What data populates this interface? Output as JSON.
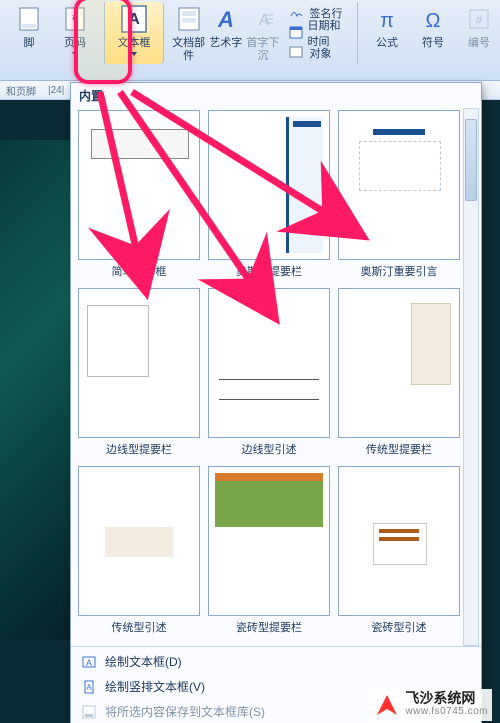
{
  "ribbon": {
    "header_footer_group": "和页脚",
    "items": {
      "footnote": "脚",
      "page_number": "页码",
      "text_box": "文本框",
      "quick_parts": "文档部件",
      "word_art": "艺术字",
      "drop_cap": "首字下沉",
      "signature": "签名行",
      "date_time": "日期和时间",
      "object": "对象",
      "equation": "公式",
      "symbol": "符号",
      "number": "编号"
    }
  },
  "ruler": {
    "marks": [
      "|24|",
      "|24|"
    ]
  },
  "dropdown": {
    "title": "内置",
    "tiles": [
      {
        "label": "简单文本框"
      },
      {
        "label": "奥斯汀提要栏"
      },
      {
        "label": "奥斯汀重要引言"
      },
      {
        "label": "边线型提要栏"
      },
      {
        "label": "边线型引述"
      },
      {
        "label": "传统型提要栏"
      },
      {
        "label": "传统型引述"
      },
      {
        "label": "瓷砖型提要栏"
      },
      {
        "label": "瓷砖型引述"
      }
    ],
    "menu": [
      {
        "label": "绘制文本框(D)"
      },
      {
        "label": "绘制竖排文本框(V)"
      },
      {
        "label": "将所选内容保存到文本框库(S)"
      }
    ]
  },
  "watermark": {
    "line1": "飞沙系统网",
    "line2": "www.fs0745.com"
  }
}
